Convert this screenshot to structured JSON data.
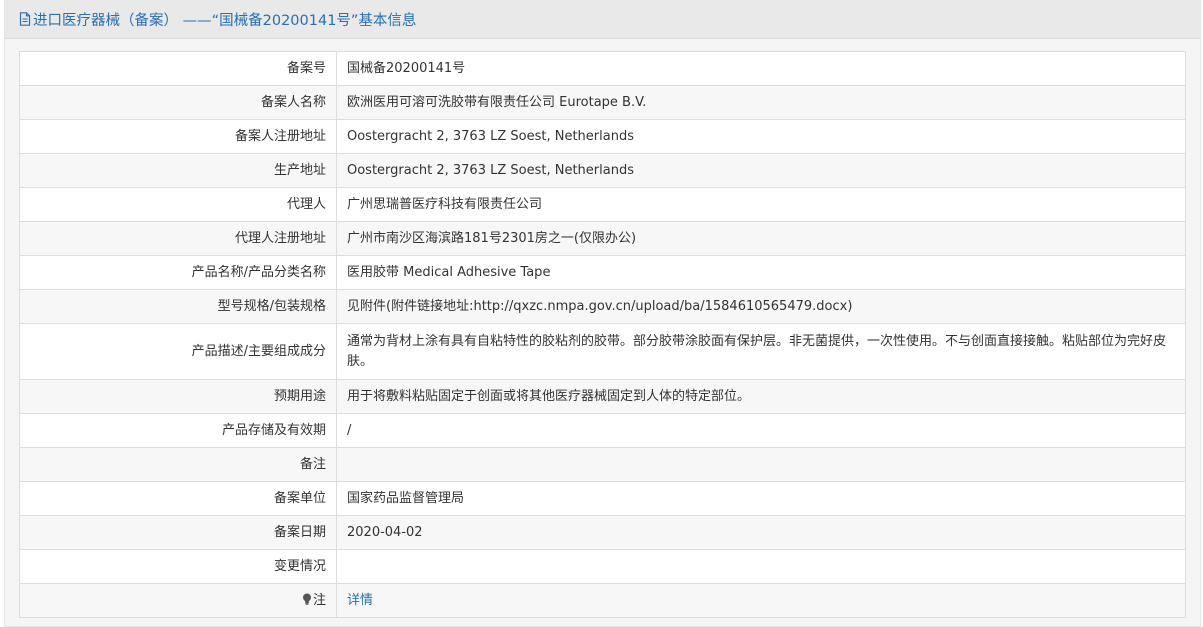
{
  "header": {
    "title": "进口医疗器械（备案） ——“国械备20200141号”基本信息",
    "icon": "document-icon"
  },
  "rows": [
    {
      "label": "备案号",
      "value": "国械备20200141号"
    },
    {
      "label": "备案人名称",
      "value": "欧洲医用可溶可洗胶带有限责任公司 Eurotape B.V."
    },
    {
      "label": "备案人注册地址",
      "value": "Oostergracht 2, 3763 LZ Soest, Netherlands"
    },
    {
      "label": "生产地址",
      "value": "Oostergracht 2, 3763 LZ Soest, Netherlands"
    },
    {
      "label": "代理人",
      "value": "广州思瑞普医疗科技有限责任公司"
    },
    {
      "label": "代理人注册地址",
      "value": "广州市南沙区海滨路181号2301房之一(仅限办公)"
    },
    {
      "label": "产品名称/产品分类名称",
      "value": "医用胶带 Medical Adhesive Tape"
    },
    {
      "label": "型号规格/包装规格",
      "value": "见附件(附件链接地址:http://qxzc.nmpa.gov.cn/upload/ba/1584610565479.docx)"
    },
    {
      "label": "产品描述/主要组成成分",
      "value": "通常为背材上涂有具有自粘特性的胶粘剂的胶带。部分胶带涂胶面有保护层。非无菌提供，一次性使用。不与创面直接接触。粘贴部位为完好皮肤。"
    },
    {
      "label": "预期用途",
      "value": "用于将敷料粘贴固定于创面或将其他医疗器械固定到人体的特定部位。"
    },
    {
      "label": "产品存储及有效期",
      "value": "/"
    },
    {
      "label": "备注",
      "value": ""
    },
    {
      "label": "备案单位",
      "value": "国家药品监督管理局"
    },
    {
      "label": "备案日期",
      "value": "2020-04-02"
    },
    {
      "label": "变更情况",
      "value": ""
    }
  ],
  "note": {
    "label": "注",
    "link_text": "详情",
    "icon": "lightbulb-icon"
  },
  "colors": {
    "accent": "#2a6fb0",
    "header_bg": "#e9e9e9",
    "border": "#dddddd",
    "stripe": "#f7f7f7"
  }
}
